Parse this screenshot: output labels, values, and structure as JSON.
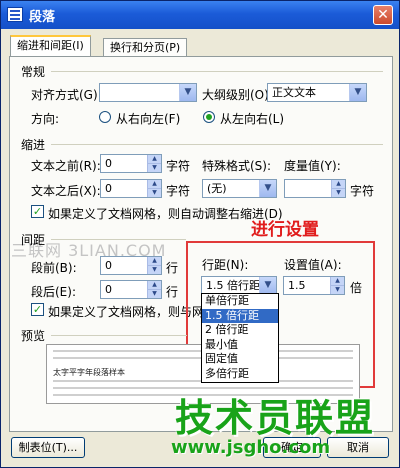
{
  "window": {
    "title": "段落",
    "close_glyph": "✕"
  },
  "tabs": [
    {
      "label": "缩进和间距(I)",
      "active": true
    },
    {
      "label": "换行和分页(P)",
      "active": false
    }
  ],
  "general": {
    "heading": "常规",
    "align_label": "对齐方式(G):",
    "align_value": "",
    "outline_label": "大纲级别(O):",
    "outline_value": "正文文本",
    "direction_label": "方向:",
    "rtl_label": "从右向左(F)",
    "ltr_label": "从左向右(L)",
    "direction_selected": "ltr"
  },
  "indent": {
    "heading": "缩进",
    "before_label": "文本之前(R):",
    "before_value": "0",
    "before_unit": "字符",
    "special_label": "特殊格式(S):",
    "measure_label": "度量值(Y):",
    "after_label": "文本之后(X):",
    "after_value": "0",
    "after_unit": "字符",
    "special_value": "(无)",
    "measure_value": "",
    "measure_unit": "字符",
    "auto_adjust_label": "如果定义了文档网格，则自动调整右缩进(D)",
    "auto_adjust_checked": true
  },
  "spacing": {
    "heading": "间距",
    "before_label": "段前(B):",
    "before_value": "0",
    "before_unit": "行",
    "after_label": "段后(E):",
    "after_value": "0",
    "after_unit": "行",
    "line_label": "行距(N):",
    "line_value": "1.5 倍行距",
    "setting_label": "设置值(A):",
    "setting_value": "1.5",
    "setting_unit": "倍",
    "grid_label": "如果定义了文档网格，则与网格对",
    "grid_checked": true,
    "line_options": [
      "单倍行距",
      "1.5 倍行距",
      "2 倍行距",
      "最小值",
      "固定值",
      "多倍行距"
    ],
    "line_selected_index": 1
  },
  "preview": {
    "heading": "预览",
    "sample_text": "太字平字年段落样本"
  },
  "annotation": {
    "text": "进行设置",
    "color": "#e11c1c"
  },
  "watermark": {
    "text": "三联网 3LIAN.COM"
  },
  "footer": {
    "tabs_button": "制表位(T)...",
    "ok_button": "确定",
    "cancel_button": "取消"
  },
  "logo": {
    "text": "技术员联盟",
    "url": "www.jsgho.com",
    "color": "#19a319"
  },
  "colors": {
    "titlebar": "#1b5bd8",
    "dialog_bg": "#ece9d8",
    "selection": "#316ac5",
    "callout": "#e13a3a"
  }
}
